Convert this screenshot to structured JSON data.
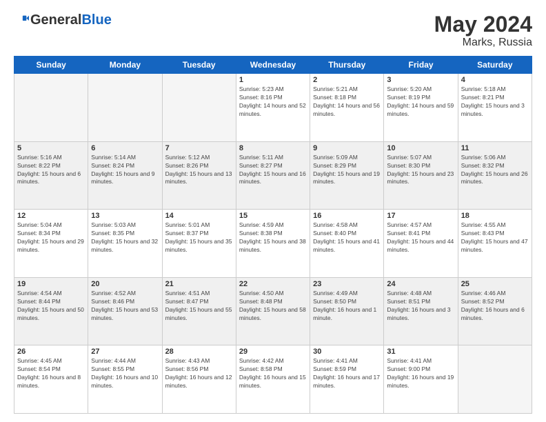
{
  "header": {
    "logo_general": "General",
    "logo_blue": "Blue",
    "title": "May 2024",
    "location": "Marks, Russia"
  },
  "weekdays": [
    "Sunday",
    "Monday",
    "Tuesday",
    "Wednesday",
    "Thursday",
    "Friday",
    "Saturday"
  ],
  "weeks": [
    [
      {
        "day": "",
        "empty": true
      },
      {
        "day": "",
        "empty": true
      },
      {
        "day": "",
        "empty": true
      },
      {
        "day": "1",
        "sunrise": "5:23 AM",
        "sunset": "8:16 PM",
        "daylight": "14 hours and 52 minutes."
      },
      {
        "day": "2",
        "sunrise": "5:21 AM",
        "sunset": "8:18 PM",
        "daylight": "14 hours and 56 minutes."
      },
      {
        "day": "3",
        "sunrise": "5:20 AM",
        "sunset": "8:19 PM",
        "daylight": "14 hours and 59 minutes."
      },
      {
        "day": "4",
        "sunrise": "5:18 AM",
        "sunset": "8:21 PM",
        "daylight": "15 hours and 3 minutes."
      }
    ],
    [
      {
        "day": "5",
        "sunrise": "5:16 AM",
        "sunset": "8:22 PM",
        "daylight": "15 hours and 6 minutes."
      },
      {
        "day": "6",
        "sunrise": "5:14 AM",
        "sunset": "8:24 PM",
        "daylight": "15 hours and 9 minutes."
      },
      {
        "day": "7",
        "sunrise": "5:12 AM",
        "sunset": "8:26 PM",
        "daylight": "15 hours and 13 minutes."
      },
      {
        "day": "8",
        "sunrise": "5:11 AM",
        "sunset": "8:27 PM",
        "daylight": "15 hours and 16 minutes."
      },
      {
        "day": "9",
        "sunrise": "5:09 AM",
        "sunset": "8:29 PM",
        "daylight": "15 hours and 19 minutes."
      },
      {
        "day": "10",
        "sunrise": "5:07 AM",
        "sunset": "8:30 PM",
        "daylight": "15 hours and 23 minutes."
      },
      {
        "day": "11",
        "sunrise": "5:06 AM",
        "sunset": "8:32 PM",
        "daylight": "15 hours and 26 minutes."
      }
    ],
    [
      {
        "day": "12",
        "sunrise": "5:04 AM",
        "sunset": "8:34 PM",
        "daylight": "15 hours and 29 minutes."
      },
      {
        "day": "13",
        "sunrise": "5:03 AM",
        "sunset": "8:35 PM",
        "daylight": "15 hours and 32 minutes."
      },
      {
        "day": "14",
        "sunrise": "5:01 AM",
        "sunset": "8:37 PM",
        "daylight": "15 hours and 35 minutes."
      },
      {
        "day": "15",
        "sunrise": "4:59 AM",
        "sunset": "8:38 PM",
        "daylight": "15 hours and 38 minutes."
      },
      {
        "day": "16",
        "sunrise": "4:58 AM",
        "sunset": "8:40 PM",
        "daylight": "15 hours and 41 minutes."
      },
      {
        "day": "17",
        "sunrise": "4:57 AM",
        "sunset": "8:41 PM",
        "daylight": "15 hours and 44 minutes."
      },
      {
        "day": "18",
        "sunrise": "4:55 AM",
        "sunset": "8:43 PM",
        "daylight": "15 hours and 47 minutes."
      }
    ],
    [
      {
        "day": "19",
        "sunrise": "4:54 AM",
        "sunset": "8:44 PM",
        "daylight": "15 hours and 50 minutes."
      },
      {
        "day": "20",
        "sunrise": "4:52 AM",
        "sunset": "8:46 PM",
        "daylight": "15 hours and 53 minutes."
      },
      {
        "day": "21",
        "sunrise": "4:51 AM",
        "sunset": "8:47 PM",
        "daylight": "15 hours and 55 minutes."
      },
      {
        "day": "22",
        "sunrise": "4:50 AM",
        "sunset": "8:48 PM",
        "daylight": "15 hours and 58 minutes."
      },
      {
        "day": "23",
        "sunrise": "4:49 AM",
        "sunset": "8:50 PM",
        "daylight": "16 hours and 1 minute."
      },
      {
        "day": "24",
        "sunrise": "4:48 AM",
        "sunset": "8:51 PM",
        "daylight": "16 hours and 3 minutes."
      },
      {
        "day": "25",
        "sunrise": "4:46 AM",
        "sunset": "8:52 PM",
        "daylight": "16 hours and 6 minutes."
      }
    ],
    [
      {
        "day": "26",
        "sunrise": "4:45 AM",
        "sunset": "8:54 PM",
        "daylight": "16 hours and 8 minutes."
      },
      {
        "day": "27",
        "sunrise": "4:44 AM",
        "sunset": "8:55 PM",
        "daylight": "16 hours and 10 minutes."
      },
      {
        "day": "28",
        "sunrise": "4:43 AM",
        "sunset": "8:56 PM",
        "daylight": "16 hours and 12 minutes."
      },
      {
        "day": "29",
        "sunrise": "4:42 AM",
        "sunset": "8:58 PM",
        "daylight": "16 hours and 15 minutes."
      },
      {
        "day": "30",
        "sunrise": "4:41 AM",
        "sunset": "8:59 PM",
        "daylight": "16 hours and 17 minutes."
      },
      {
        "day": "31",
        "sunrise": "4:41 AM",
        "sunset": "9:00 PM",
        "daylight": "16 hours and 19 minutes."
      },
      {
        "day": "",
        "empty": true
      }
    ]
  ]
}
